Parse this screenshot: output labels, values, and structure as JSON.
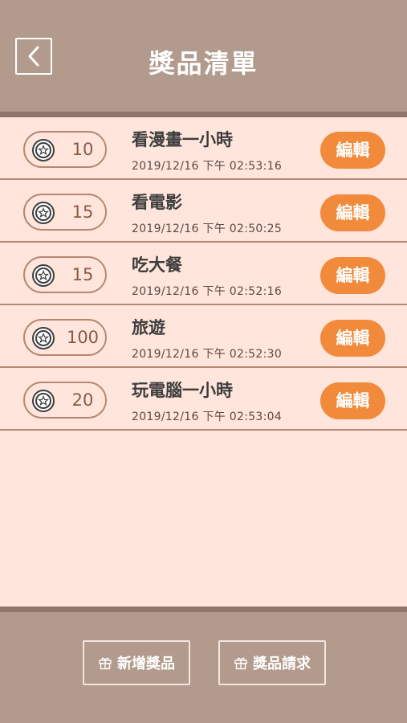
{
  "header": {
    "title": "獎品清單",
    "back_icon": "chevron-left-icon"
  },
  "prizes": [
    {
      "points": "10",
      "name": "看漫畫一小時",
      "time": "2019/12/16 下午 02:53:16",
      "edit_label": "編輯"
    },
    {
      "points": "15",
      "name": "看電影",
      "time": "2019/12/16 下午 02:50:25",
      "edit_label": "編輯"
    },
    {
      "points": "15",
      "name": "吃大餐",
      "time": "2019/12/16 下午 02:52:16",
      "edit_label": "編輯"
    },
    {
      "points": "100",
      "name": "旅遊",
      "time": "2019/12/16 下午 02:52:30",
      "edit_label": "編輯"
    },
    {
      "points": "20",
      "name": "玩電腦一小時",
      "time": "2019/12/16 下午 02:53:04",
      "edit_label": "編輯"
    }
  ],
  "footer": {
    "add_prize_label": "新增獎品",
    "prize_request_label": "獎品請求",
    "icon": "gift-icon"
  },
  "colors": {
    "header_bg": "#b29a8c",
    "page_bg": "#ffe5dc",
    "accent": "#f28a3c",
    "border": "#b58772"
  }
}
